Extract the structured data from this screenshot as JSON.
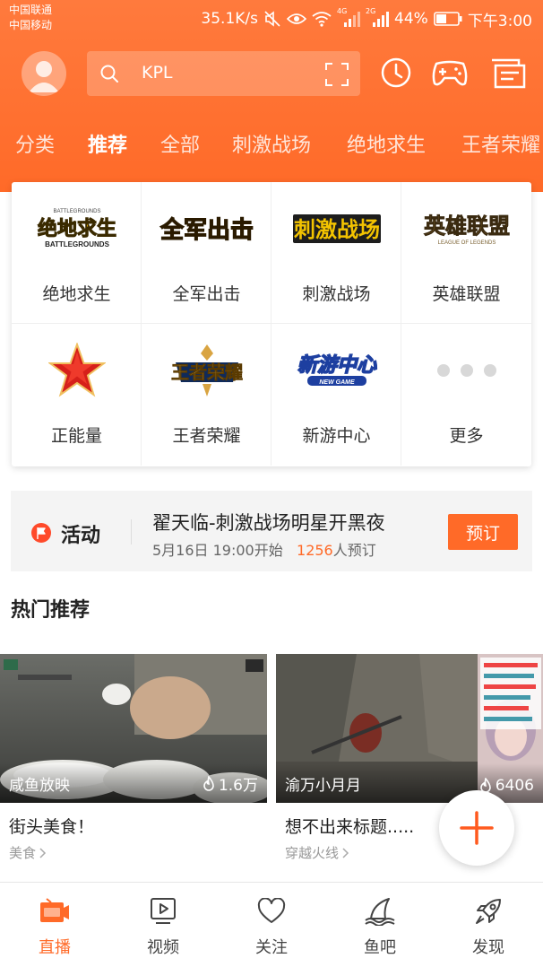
{
  "status_bar": {
    "carrier_1": "中国联通",
    "carrier_2": "中国移动",
    "net_speed": "35.1K/s",
    "sig_4g": "4G",
    "sig_2g": "2G",
    "battery": "44%",
    "time": "下午3:00"
  },
  "header": {
    "search_value": "KPL",
    "icons": [
      "history-icon",
      "gamepad-icon",
      "message-icon"
    ]
  },
  "tabs": [
    {
      "label": "分类"
    },
    {
      "label": "推荐",
      "active": true
    },
    {
      "label": "全部"
    },
    {
      "label": "刺激战场"
    },
    {
      "label": "绝地求生"
    },
    {
      "label": "王者荣耀"
    }
  ],
  "games": [
    {
      "label": "绝地求生",
      "logo_text": "绝地求生",
      "logo_sub": "BATTLEGROUNDS"
    },
    {
      "label": "全军出击",
      "logo_text": "全军出击"
    },
    {
      "label": "刺激战场",
      "logo_text": "刺激战场"
    },
    {
      "label": "英雄联盟",
      "logo_text": "英雄联盟",
      "logo_sub": "LEAGUE OF LEGENDS"
    },
    {
      "label": "正能量"
    },
    {
      "label": "王者荣耀",
      "logo_text": "王者荣耀"
    },
    {
      "label": "新游中心",
      "logo_text": "新游中心",
      "logo_sub": "NEW GAME"
    },
    {
      "label": "更多"
    }
  ],
  "activity": {
    "tag": "活动",
    "title": "翟天临-刺激战场明星开黑夜",
    "time": "5月16日  19:00开始",
    "count": "1256",
    "count_suffix": "人预订",
    "button": "预订"
  },
  "section": {
    "title": "热门推荐"
  },
  "videos": [
    {
      "streamer": "咸鱼放映",
      "hot": "1.6万",
      "title": "街头美食！",
      "category": "美食"
    },
    {
      "streamer": "渝万小月月",
      "hot": "6406",
      "title": "想不出来标题.....",
      "category": "穿越火线"
    }
  ],
  "nav": [
    {
      "label": "直播",
      "active": true
    },
    {
      "label": "视频"
    },
    {
      "label": "关注"
    },
    {
      "label": "鱼吧"
    },
    {
      "label": "发现"
    }
  ],
  "colors": {
    "accent": "#ff6a28",
    "header": "#ff7a3d"
  }
}
